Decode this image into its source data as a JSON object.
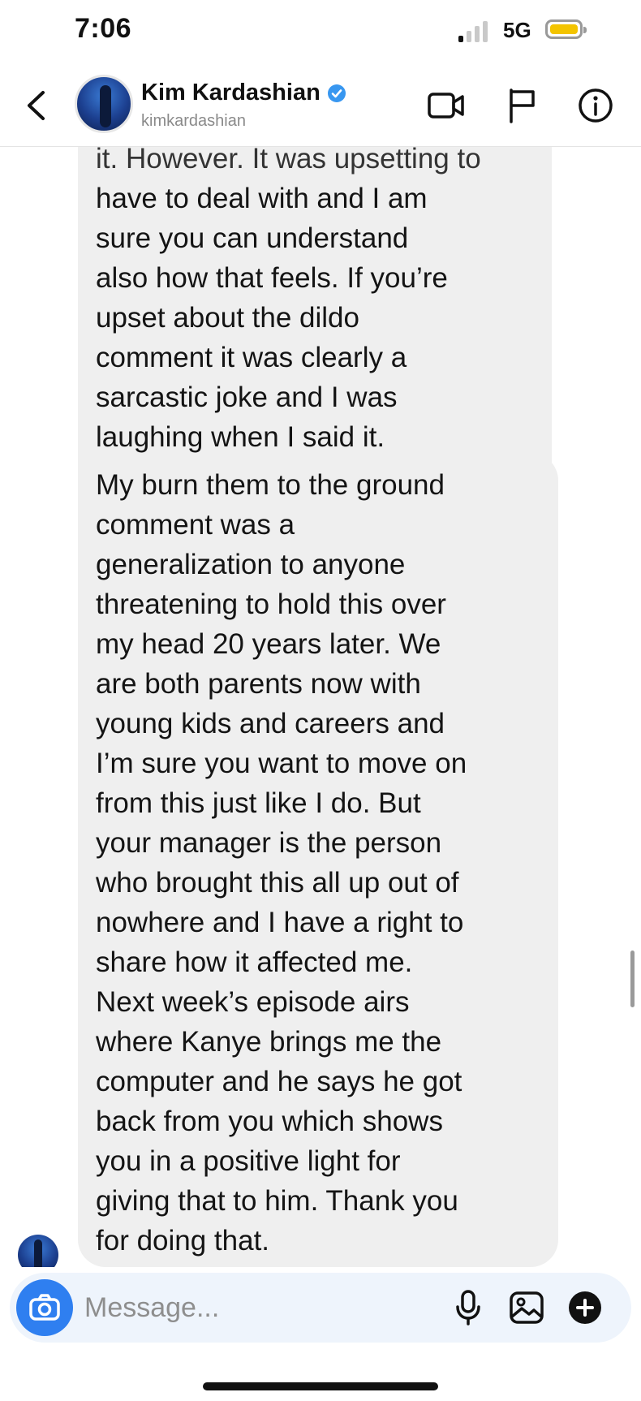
{
  "status_bar": {
    "time": "7:06",
    "network": "5G"
  },
  "header": {
    "contact_name": "Kim Kardashian",
    "contact_handle": "kimkardashian",
    "icons": [
      "back-icon",
      "verified-icon",
      "video-call-icon",
      "flag-icon",
      "info-icon"
    ]
  },
  "messages": [
    {
      "id": 1,
      "lines": [
        "it. However. It was upsetting to",
        "have to deal with and I am",
        "sure you can understand",
        "also how that feels. If you’re",
        "upset about the dildo",
        "comment it was clearly a",
        "sarcastic joke and I was",
        "laughing when I said it."
      ]
    },
    {
      "id": 2,
      "lines": [
        "My burn them to the ground",
        "comment was a",
        "generalization to anyone",
        "threatening to hold this over",
        "my head 20 years later. We",
        "are both parents now with",
        "young kids and careers and",
        "I’m sure you want to move on",
        "from this just like I do. But",
        "your manager is the person",
        "who brought this all up out of",
        "nowhere and I have a right to",
        "share how it affected me.",
        "Next week’s episode airs",
        "where Kanye brings me the",
        "computer and he says he got",
        "back from you which shows",
        "you in a positive light for",
        "giving that to him. Thank you",
        "for doing that."
      ]
    }
  ],
  "composer": {
    "placeholder": "Message...",
    "value": "",
    "icons": [
      "camera-icon",
      "microphone-icon",
      "gallery-icon",
      "add-icon"
    ]
  },
  "colors": {
    "accent": "#2f7ff0",
    "bubble": "#efefef",
    "composer_bg": "#eef4fc",
    "battery": "#f3c400",
    "verified": "#3897f0"
  }
}
